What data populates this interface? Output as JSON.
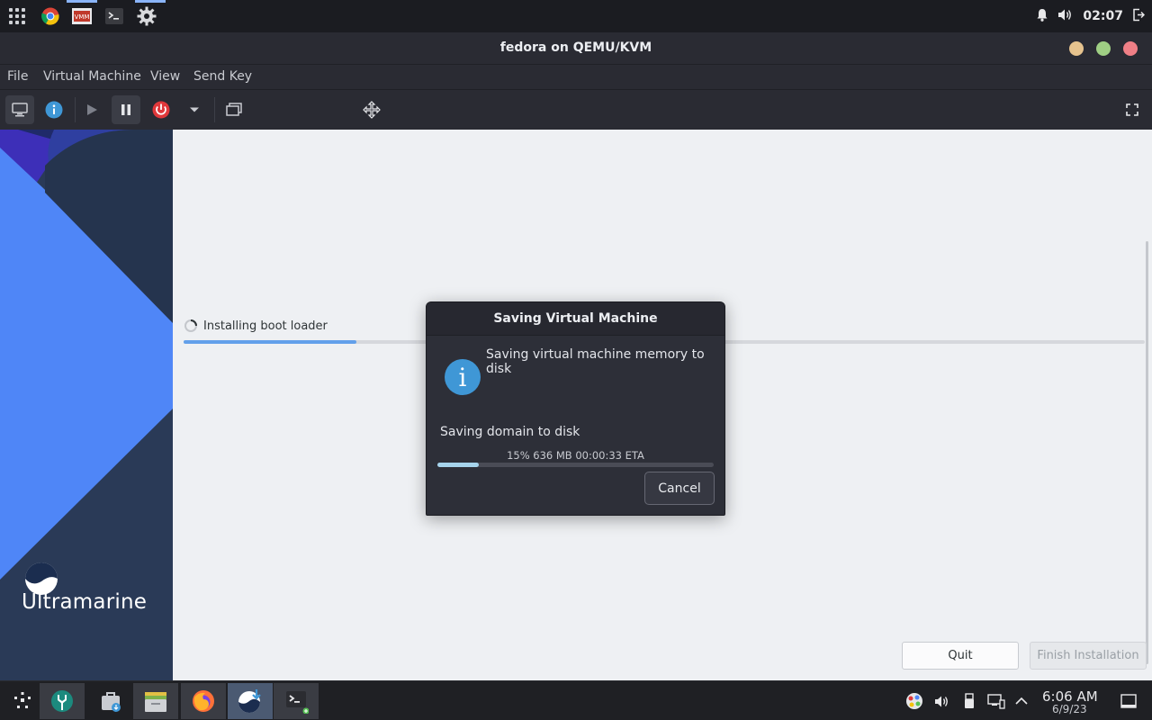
{
  "topbar": {
    "clock": "02:07"
  },
  "window": {
    "title": "fedora on QEMU/KVM"
  },
  "menu": {
    "items": [
      "File",
      "Virtual Machine",
      "View",
      "Send Key"
    ]
  },
  "installer": {
    "brand": "Ultramarine",
    "status": "Installing boot loader",
    "progress": 0.18,
    "quit_label": "Quit",
    "finish_label": "Finish Installation"
  },
  "dialog": {
    "title": "Saving Virtual Machine",
    "message": "Saving virtual machine memory to disk",
    "subtitle": "Saving domain to disk",
    "progress_text": "15% 636 MB 00:00:33 ETA",
    "progress": 0.15,
    "cancel_label": "Cancel"
  },
  "taskbar": {
    "time": "6:06 AM",
    "date": "6/9/23"
  },
  "colors": {
    "accent": "#62a0ea",
    "brand_blue": "#4f86f7",
    "dialog_bg": "#2d2f38"
  }
}
